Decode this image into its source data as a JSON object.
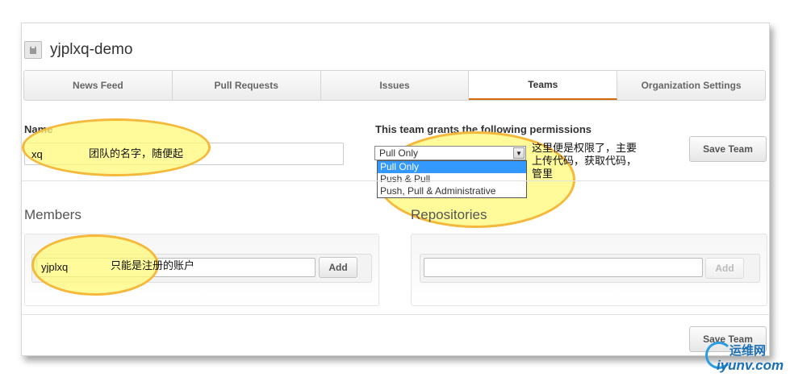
{
  "org": {
    "name": "yjplxq-demo"
  },
  "tabs": [
    {
      "label": "News Feed"
    },
    {
      "label": "Pull Requests"
    },
    {
      "label": "Issues"
    },
    {
      "label": "Teams",
      "active": true
    },
    {
      "label": "Organization Settings"
    }
  ],
  "team_form": {
    "name_label": "Name",
    "name_value": "xq",
    "name_annotation": "团队的名字，随便起",
    "permissions_label": "This team grants the following permissions",
    "permissions_selected": "Pull Only",
    "permissions_options": [
      "Pull Only",
      "Push & Pull",
      "Push, Pull & Administrative"
    ],
    "permissions_annotation": "这里便是权限了，主要上传代码，获取代码，管里",
    "save_label": "Save Team"
  },
  "members": {
    "title": "Members",
    "input_value": "yjplxq",
    "annotation": "只能是注册的账户",
    "add_label": "Add"
  },
  "repositories": {
    "title": "Repositories",
    "input_value": "",
    "add_label": "Add"
  },
  "bottom": {
    "save_label": "Save Team"
  },
  "watermark": {
    "top": "运维网",
    "bottom": "iyunv.com"
  },
  "colors": {
    "active_tab_border": "#d26911",
    "highlight": "#fff878",
    "highlight_border": "#f6b83a"
  }
}
